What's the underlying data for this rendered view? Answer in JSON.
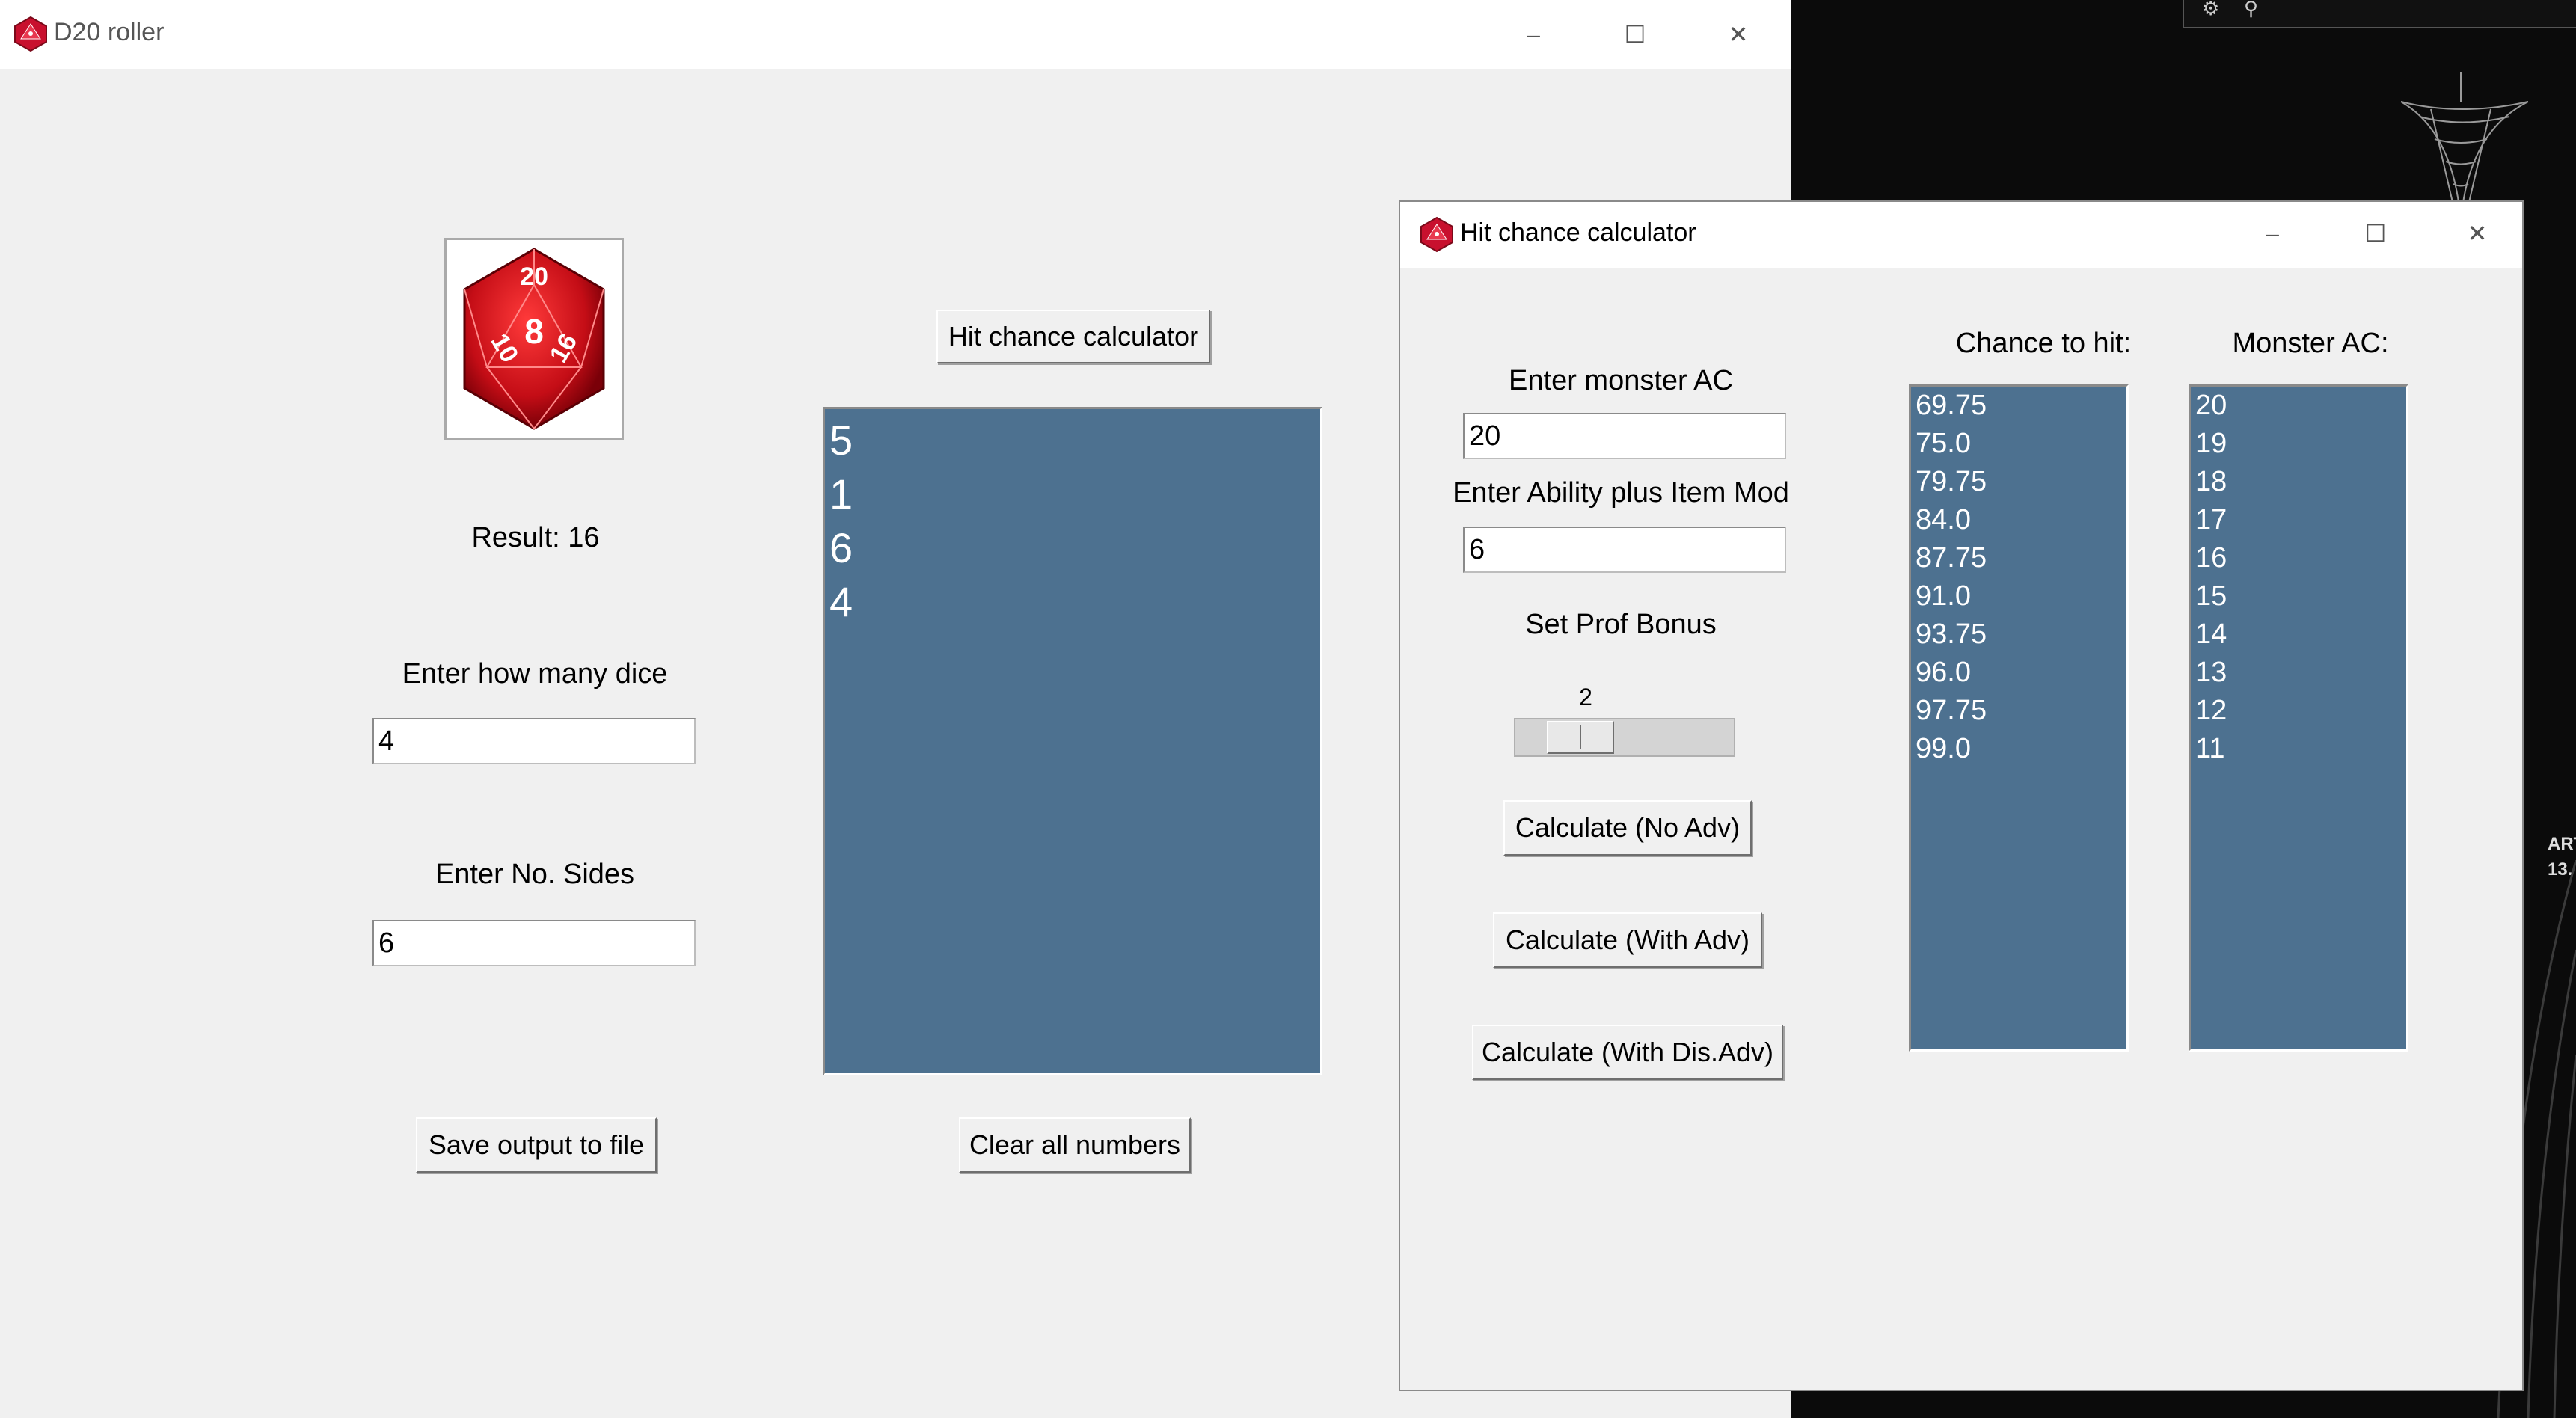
{
  "d20_window": {
    "title": "D20 roller",
    "result_label": "Result: 16",
    "dice_count_label": "Enter how many dice",
    "dice_count_value": "4",
    "sides_label": "Enter No. Sides",
    "sides_value": "6",
    "hit_chance_button": "Hit chance calculator",
    "rolls": [
      "5",
      "1",
      "6",
      "4"
    ],
    "save_button": "Save output to file",
    "clear_button": "Clear all numbers",
    "die_faces": [
      "20",
      "8",
      "10",
      "16"
    ]
  },
  "hit_window": {
    "title": "Hit chance calculator",
    "monster_ac_label": "Enter monster AC",
    "monster_ac_value": "20",
    "ability_label": "Enter Ability plus Item Mod",
    "ability_value": "6",
    "prof_label": "Set Prof Bonus",
    "prof_value": "2",
    "calc_no_adv": "Calculate (No Adv)",
    "calc_with_adv": "Calculate (With Adv)",
    "calc_dis_adv": "Calculate (With Dis.Adv)",
    "chance_header": "Chance to hit:",
    "ac_header": "Monster AC:",
    "chances": [
      "69.75",
      "75.0",
      "79.75",
      "84.0",
      "87.75",
      "91.0",
      "93.75",
      "96.0",
      "97.75",
      "99.0"
    ],
    "acs": [
      "20",
      "19",
      "18",
      "17",
      "16",
      "15",
      "14",
      "13",
      "12",
      "11"
    ]
  },
  "window_controls": {
    "minimize": "–",
    "maximize": "☐",
    "close": "✕"
  },
  "desktop": {
    "corner_text_1": "ART",
    "corner_text_2": "13."
  },
  "colors": {
    "listbox": "#4d7190",
    "window_bg": "#f0f0f0",
    "desktop": "#0b0b0b"
  }
}
